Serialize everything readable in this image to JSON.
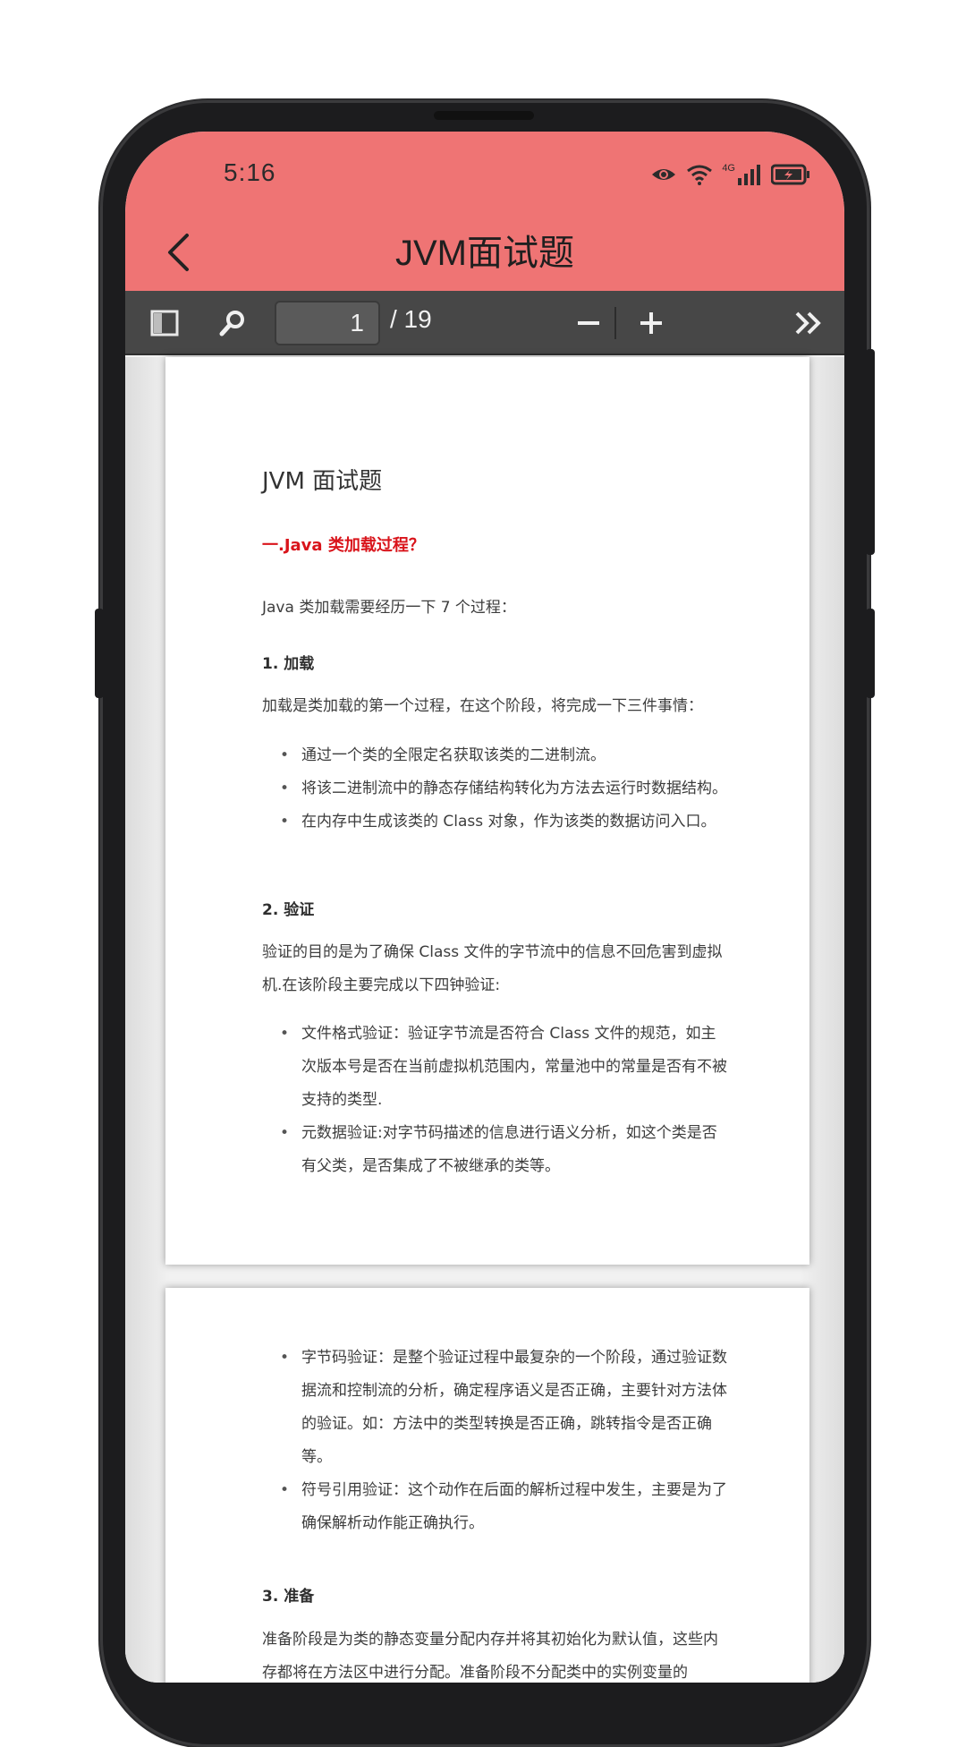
{
  "status_bar": {
    "time": "5:16",
    "network_label": "4G",
    "icons": [
      "eye-icon",
      "wifi-icon",
      "signal-icon",
      "battery-icon"
    ]
  },
  "app_bar": {
    "title": "JVM面试题",
    "back_icon": "chevron-left-icon",
    "color": "#ef7474"
  },
  "toolbar": {
    "current_page": "1",
    "total_pages": "/ 19",
    "icons": [
      "sidebar-toggle-icon",
      "search-icon",
      "minus-icon",
      "plus-icon",
      "double-chevron-right-icon"
    ]
  },
  "document": {
    "page1": {
      "title": "JVM 面试题",
      "red_heading": "一.Java 类加载过程？",
      "intro": "Java 类加载需要经历一下 7 个过程：",
      "section1_heading": "1. 加载",
      "section1_text": "加载是类加载的第一个过程，在这个阶段，将完成一下三件事情：",
      "section1_bullets": [
        "通过一个类的全限定名获取该类的二进制流。",
        "将该二进制流中的静态存储结构转化为方法去运行时数据结构。",
        "在内存中生成该类的 Class 对象，作为该类的数据访问入口。"
      ],
      "section2_heading": "2. 验证",
      "section2_text": "验证的目的是为了确保 Class 文件的字节流中的信息不回危害到虚拟机.在该阶段主要完成以下四钟验证:",
      "section2_bullets": [
        "文件格式验证：验证字节流是否符合 Class 文件的规范，如主次版本号是否在当前虚拟机范围内，常量池中的常量是否有不被支持的类型.",
        "元数据验证:对字节码描述的信息进行语义分析，如这个类是否有父类，是否集成了不被继承的类等。"
      ]
    },
    "page2": {
      "bullets": [
        "字节码验证：是整个验证过程中最复杂的一个阶段，通过验证数据流和控制流的分析，确定程序语义是否正确，主要针对方法体的验证。如：方法中的类型转换是否正确，跳转指令是否正确等。",
        "符号引用验证：这个动作在后面的解析过程中发生，主要是为了确保解析动作能正确执行。"
      ],
      "section3_heading": "3. 准备",
      "section3_text": "准备阶段是为类的静态变量分配内存并将其初始化为默认值，这些内存都将在方法区中进行分配。准备阶段不分配类中的实例变量的"
    }
  }
}
